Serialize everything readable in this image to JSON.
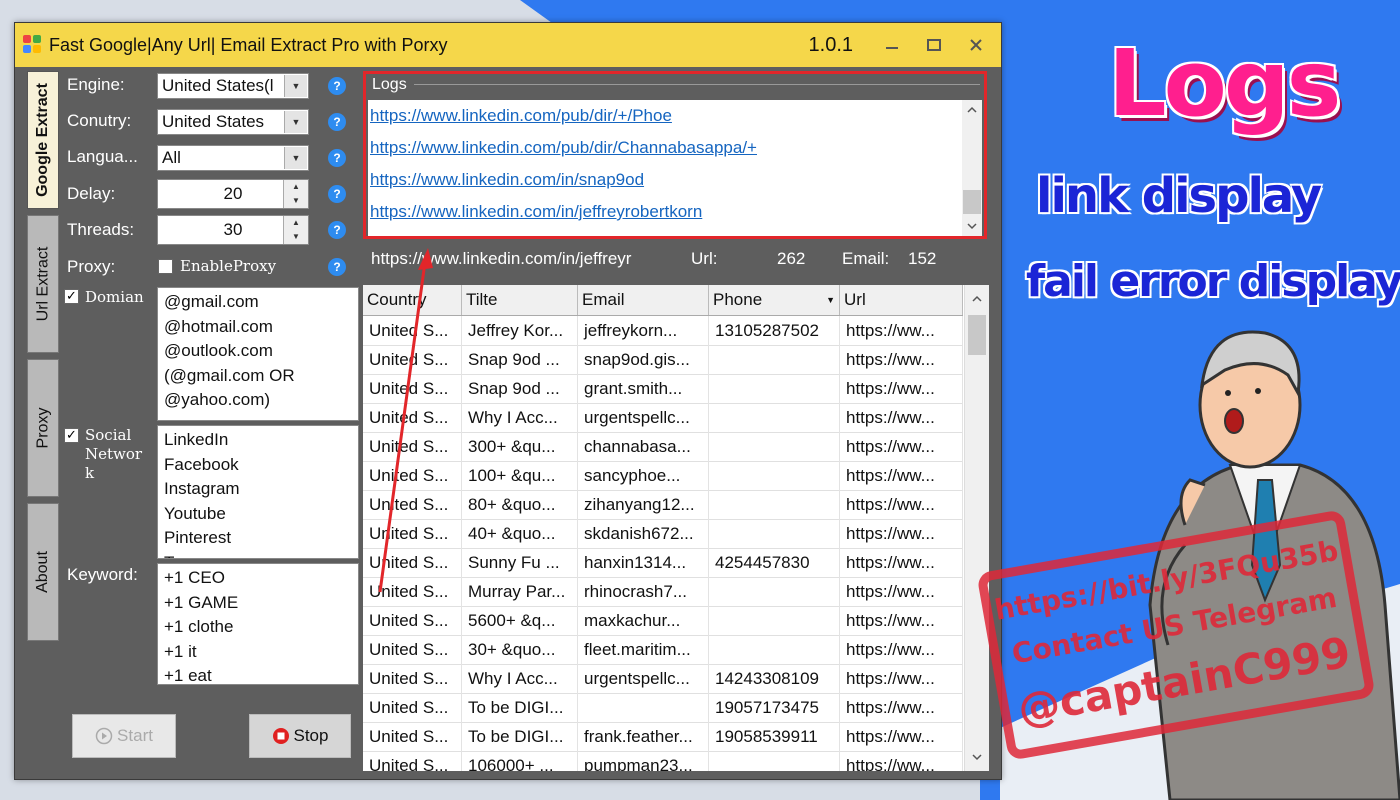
{
  "window": {
    "title": "Fast Google|Any Url| Email Extract Pro with Porxy",
    "version": "1.0.1",
    "controls": [
      "minimize-icon",
      "maximize-icon",
      "close-icon"
    ]
  },
  "tabs": [
    {
      "label": "Google Extract",
      "active": true
    },
    {
      "label": "Url Extract",
      "active": false
    },
    {
      "label": "Proxy",
      "active": false
    },
    {
      "label": "About",
      "active": false
    }
  ],
  "form": {
    "engine_label": "Engine:",
    "engine_value": "United States(l",
    "country_label": "Conutry:",
    "country_value": "United States",
    "language_label": "Langua...",
    "language_value": "All",
    "delay_label": "Delay:",
    "delay_value": "20",
    "threads_label": "Threads:",
    "threads_value": "30",
    "proxy_label": "Proxy:",
    "proxy_checkbox": "EnableProxy",
    "domain_checkbox": "Domian",
    "domains": [
      "@gmail.com",
      "@hotmail.com",
      "@outlook.com",
      "(@gmail.com OR",
      "@yahoo.com)"
    ],
    "social_checkbox_lines": [
      "Social",
      "Networ",
      "k"
    ],
    "social": [
      "LinkedIn",
      "Facebook",
      "Instagram",
      "Youtube",
      "Pinterest",
      "Tw"
    ],
    "keyword_label": "Keyword:",
    "keywords": [
      "+1 CEO",
      "+1 GAME",
      "+1 clothe",
      "+1 it",
      "+1 eat"
    ],
    "help_glyph": "?"
  },
  "buttons": {
    "start": "Start",
    "stop": "Stop"
  },
  "logs": {
    "legend": "Logs",
    "links": [
      "https://www.linkedin.com/pub/dir/+/Phoe",
      "https://www.linkedin.com/pub/dir/Channabasappa/+",
      "https://www.linkedin.com/in/snap9od",
      "https://www.linkedin.com/in/jeffreyrobertkorn"
    ]
  },
  "status": {
    "current_url": "https://www.linkedin.com/in/jeffreyr",
    "url_label": "Url:",
    "url_count": "262",
    "email_label": "Email:",
    "email_count": "152"
  },
  "table": {
    "columns": [
      "Country",
      "Tilte",
      "Email",
      "Phone",
      "Url"
    ],
    "rows": [
      [
        "United S...",
        "Jeffrey Kor...",
        "jeffreykorn...",
        "13105287502",
        "https://ww..."
      ],
      [
        "United S...",
        "Snap 9od ...",
        "snap9od.gis...",
        "",
        "https://ww..."
      ],
      [
        "United S...",
        "Snap 9od ...",
        "grant.smith...",
        "",
        "https://ww..."
      ],
      [
        "United S...",
        "Why I Acc...",
        "urgentspellc...",
        "",
        "https://ww..."
      ],
      [
        "United S...",
        "300+ &qu...",
        "channabasa...",
        "",
        "https://ww..."
      ],
      [
        "United S...",
        "100+ &qu...",
        "sancyphoe...",
        "",
        "https://ww..."
      ],
      [
        "United S...",
        "80+ &quo...",
        "zihanyang12...",
        "",
        "https://ww..."
      ],
      [
        "United S...",
        "40+ &quo...",
        "skdanish672...",
        "",
        "https://ww..."
      ],
      [
        "United S...",
        "Sunny Fu ...",
        "hanxin1314...",
        "4254457830",
        "https://ww..."
      ],
      [
        "United S...",
        "Murray Par...",
        "rhinocrash7...",
        "",
        "https://ww..."
      ],
      [
        "United S...",
        "5600+ &q...",
        "maxkachur...",
        "",
        "https://ww..."
      ],
      [
        "United S...",
        "30+ &quo...",
        "fleet.maritim...",
        "",
        "https://ww..."
      ],
      [
        "United S...",
        "Why I Acc...",
        "urgentspellc...",
        "14243308109",
        "https://ww..."
      ],
      [
        "United S...",
        "To be DIGI...",
        "",
        "19057173475",
        "https://ww..."
      ],
      [
        "United S...",
        "To be DIGI...",
        "frank.feather...",
        "19058539911",
        "https://ww..."
      ],
      [
        "United S...",
        "106000+ ...",
        "pumpman23...",
        "",
        "https://ww..."
      ]
    ]
  },
  "promo": {
    "title": "Logs",
    "line1": "link display",
    "line2": "fail  error display",
    "stamp": [
      "https://bit.ly/3FQu35b",
      "Contact US Telegram",
      "@captainC999"
    ]
  },
  "colors": {
    "titlebar": "#f5d74a",
    "accent_blue": "#2f79f0",
    "log_border": "#e2262a",
    "pink": "#ff1f8e"
  }
}
